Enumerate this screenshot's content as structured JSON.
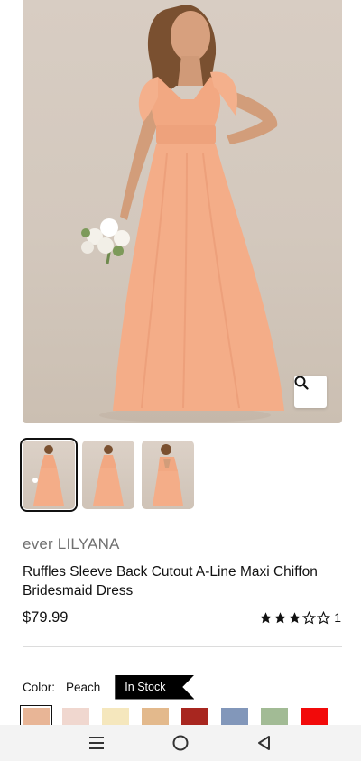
{
  "product": {
    "brand": "ever LILYANA",
    "title": "Ruffles Sleeve Back Cutout A-Line Maxi Chiffon Bridesmaid Dress",
    "price": "$79.99",
    "rating_stars": 3,
    "rating_max": 5,
    "rating_count": "1"
  },
  "gallery": {
    "zoom_icon": "magnifier-icon",
    "thumbnails": [
      "front-view",
      "back-view",
      "back-cutout-view"
    ],
    "selected_index": 0
  },
  "color": {
    "label": "Color:",
    "value": "Peach",
    "stock_badge": "In Stock",
    "swatches": [
      "#e8b596",
      "#f0d7cf",
      "#f5e7bd",
      "#e3b98c",
      "#a8261f",
      "#8297ba",
      "#a2bb95",
      "#f20a0a"
    ],
    "selected_index": 0
  },
  "navbar": {
    "icons": [
      "menu-icon",
      "home-circle-icon",
      "back-triangle-icon"
    ]
  }
}
